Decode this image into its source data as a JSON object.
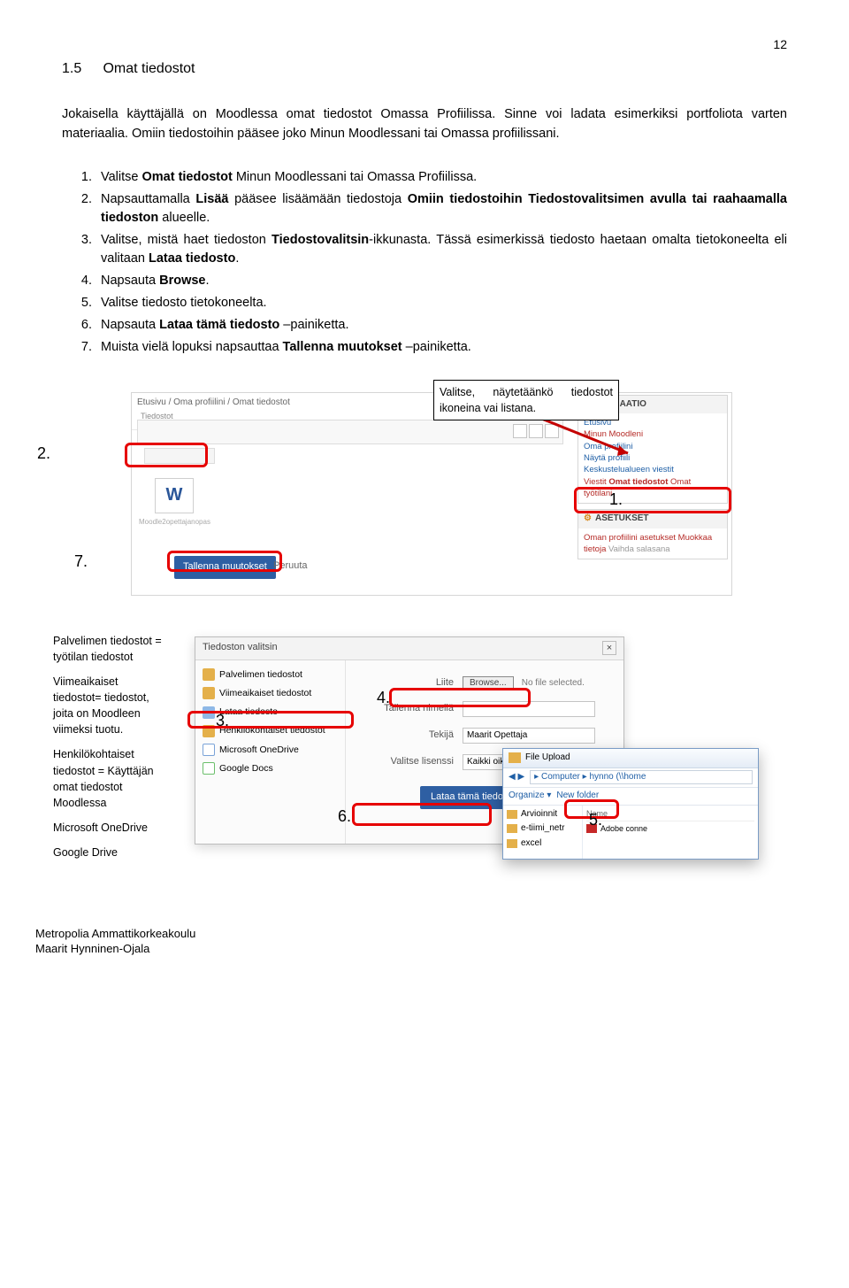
{
  "page_number": "12",
  "section_number": "1.5",
  "section_title": "Omat tiedostot",
  "intro": "Jokaisella käyttäjällä on Moodlessa omat tiedostot Omassa Profiilissa. Sinne voi ladata esimerkiksi portfoliota varten materiaalia. Omiin tiedostoihin pääsee joko Minun Moodlessani tai Omassa profiilissani.",
  "steps": {
    "s1a": "Valitse ",
    "s1b": "Omat tiedostot",
    "s1c": " Minun Moodlessani tai Omassa Profiilissa.",
    "s2a": "Napsauttamalla ",
    "s2b": "Lisää",
    "s2c": " pääsee lisäämään tiedostoja ",
    "s2d": "Omiin tiedostoihin Tiedostovalitsimen avulla tai raahaamalla tiedoston",
    "s2e": " alueelle.",
    "s3a": "Valitse, mistä haet tiedoston ",
    "s3b": "Tiedostovalitsin",
    "s3c": "-ikkunasta. Tässä esimerkissä tiedosto haetaan omalta tietokoneelta eli valitaan ",
    "s3d": "Lataa tiedosto",
    "s3e": ".",
    "s4a": "Napsauta ",
    "s4b": "Browse",
    "s4c": ".",
    "s5": "Valitse tiedosto tietokoneelta.",
    "s6a": "Napsauta ",
    "s6b": "Lataa tämä tiedosto",
    "s6c": " –painiketta.",
    "s7a": "Muista vielä lopuksi napsauttaa ",
    "s7b": "Tallenna muutokset",
    "s7c": " –painiketta."
  },
  "callout_view": "Valitse, näytetäänkö tiedostot ikoneina vai listana.",
  "nums": {
    "n1": "1.",
    "n2": "2.",
    "n3": "3.",
    "n4": "4.",
    "n5": "5.",
    "n6": "6.",
    "n7": "7."
  },
  "moodle": {
    "breadcrumb": "Etusivu / Oma profiilini / Omat tiedostot",
    "tiedostot_label": "Tiedostot",
    "wordfile": "Moodle2opettajanopas",
    "save": "Tallenna muutokset",
    "cancel": "Peruuta",
    "nav": {
      "title": "NAVIGAATIO",
      "etusivu": "Etusivu",
      "minun": "Minun Moodleni",
      "oma": "Oma profiilini",
      "nayta": "Näytä profiili",
      "keskustelu": "Keskustelualueen viestit",
      "viestit": "Viestit",
      "omat": "Omat tiedostot",
      "omattyo": "Omat työtilani"
    },
    "aset": {
      "title": "ASETUKSET",
      "o1": "Oman profiilini asetukset",
      "o2": "Muokkaa tietoja",
      "o3": "Vaihda salasana"
    }
  },
  "legend": {
    "l1": "Palvelimen tiedostot = työtilan tiedostot",
    "l2": "Viimeaikaiset tiedostot= tiedostot, joita on Moodleen viimeksi tuotu.",
    "l3": "Henkilökohtaiset tiedostot = Käyttäjän omat tiedostot Moodlessa",
    "l4": "Microsoft OneDrive",
    "l5": "Google Drive"
  },
  "picker": {
    "title": "Tiedoston valitsin",
    "left": {
      "srv": "Palvelimen tiedostot",
      "rec": "Viimeaikaiset tiedostot",
      "up": "Lataa tiedosto",
      "hk": "Henkilökohtaiset tiedostot",
      "od": "Microsoft OneDrive",
      "gd": "Google Docs"
    },
    "right": {
      "liite": "Liite",
      "browse": "Browse...",
      "nofile": "No file selected.",
      "tallenna": "Tallenna nimellä",
      "tekija": "Tekijä",
      "tekija_val": "Maarit Opettaja",
      "lisenssi": "Valitse lisenssi",
      "lisenssi_val": "Kaikki oikeudet pidätetään",
      "lataa": "Lataa tämä tiedosto"
    }
  },
  "win": {
    "title": "File Upload",
    "path": "▸ Computer ▸ hynno (\\\\home",
    "organize": "Organize ▾",
    "newfolder": "New folder",
    "side": {
      "a": "Arvioinnit",
      "b": "e-tiimi_netr",
      "c": "excel"
    },
    "hdr": "Name",
    "adobe": "Adobe conne"
  },
  "footer": {
    "l1": "Metropolia Ammattikorkeakoulu",
    "l2": "Maarit Hynninen-Ojala"
  }
}
